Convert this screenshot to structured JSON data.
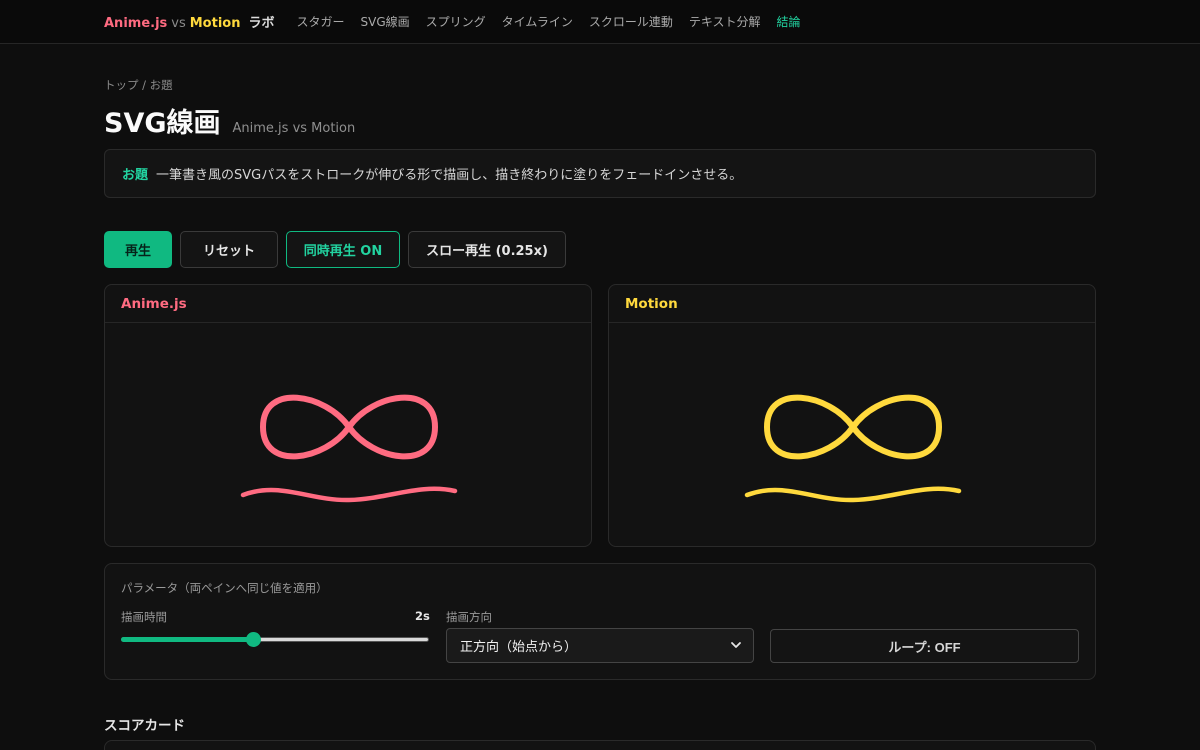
{
  "nav": {
    "brand_anime": "Anime.js",
    "brand_vs": "vs",
    "brand_motion": "Motion",
    "brand_lab": "ラボ",
    "links": [
      "スタガー",
      "SVG線画",
      "スプリング",
      "タイムライン",
      "スクロール連動",
      "テキスト分解",
      "結論"
    ],
    "active_link": "結論"
  },
  "breadcrumb": "トップ / お題",
  "page": {
    "title": "SVG線画",
    "subtitle": "Anime.js vs Motion"
  },
  "task": {
    "tag": "お題",
    "text": "一筆書き風のSVGパスをストロークが伸びる形で描画し、描き終わりに塗りをフェードインさせる。"
  },
  "controls": {
    "play": "再生",
    "reset": "リセット",
    "sync": "同時再生 ON",
    "slow": "スロー再生 (0.25x)"
  },
  "panes": {
    "left": {
      "label": "Anime.js",
      "stroke_color": "#ff6b81"
    },
    "right": {
      "label": "Motion",
      "stroke_color": "#ffd93d"
    }
  },
  "params": {
    "title": "パラメータ（両ペインへ同じ値を適用）",
    "duration_label": "描画時間",
    "duration_value": "2s",
    "duration_fraction": 0.43,
    "direction_label": "描画方向",
    "direction_selected": "正方向（始点から）",
    "loop_label": "ループ: OFF"
  },
  "scorecard": {
    "title": "スコアカード"
  },
  "colors": {
    "accent": "#10b981",
    "accent_text": "#22d3a0",
    "anime": "#ff6b81",
    "motion": "#ffd93d"
  }
}
